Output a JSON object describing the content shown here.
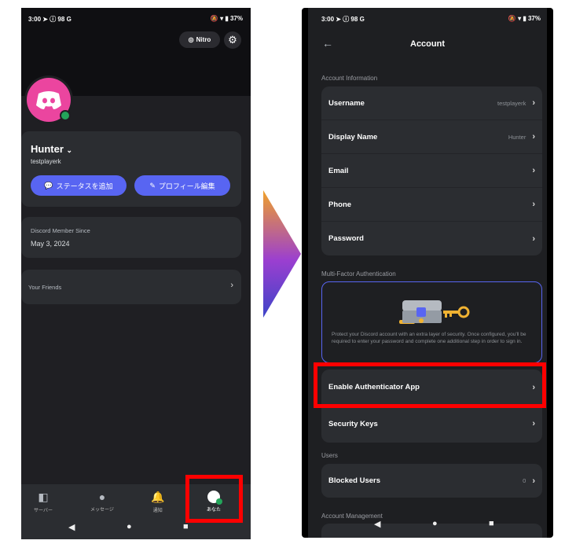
{
  "left_phone": {
    "status_time": "3:00",
    "status_extra": "98",
    "status_battery": "37%",
    "nitro_label": "Nitro",
    "display_name": "Hunter",
    "username": "testplayerk",
    "add_status_label": "ステータスを追加",
    "edit_profile_label": "プロフィール編集",
    "member_since_label": "Discord Member Since",
    "member_since_date": "May 3, 2024",
    "friends_label": "Your Friends",
    "nav": {
      "servers": "サーバー",
      "messages": "メッセージ",
      "notifications": "通知",
      "you": "あなた"
    }
  },
  "right_phone": {
    "status_time": "3:00",
    "status_extra": "98",
    "status_battery": "37%",
    "title": "Account",
    "section_account_info": "Account Information",
    "account_rows": [
      {
        "label": "Username",
        "value": "testplayerk"
      },
      {
        "label": "Display Name",
        "value": "Hunter"
      },
      {
        "label": "Email",
        "value": ""
      },
      {
        "label": "Phone",
        "value": ""
      },
      {
        "label": "Password",
        "value": ""
      }
    ],
    "section_mfa": "Multi-Factor Authentication",
    "mfa_description": "Protect your Discord account with an extra layer of security. Once configured, you'll be required to enter your password and complete one additional step in order to sign in.",
    "enable_authenticator_label": "Enable Authenticator App",
    "security_keys_label": "Security Keys",
    "section_users": "Users",
    "blocked_users_label": "Blocked Users",
    "blocked_users_count": "0",
    "section_account_management": "Account Management"
  },
  "colors": {
    "highlight": "#ff0000",
    "blurple": "#5865f2",
    "avatar_pink": "#eb459f",
    "online_green": "#23a55a"
  }
}
